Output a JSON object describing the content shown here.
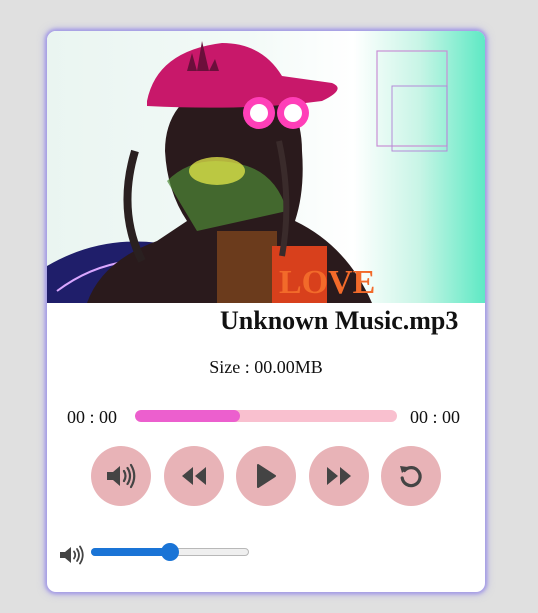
{
  "track": {
    "title": "Unknown Music.mp3",
    "size_label": "Size : ",
    "size_value": "00.00MB"
  },
  "progress": {
    "current_time": "00 : 00",
    "duration": "00 : 00",
    "fraction": 0.4
  },
  "controls": {
    "buttons": [
      {
        "icon": "volume-up-icon"
      },
      {
        "icon": "rewind-icon"
      },
      {
        "icon": "play-icon"
      },
      {
        "icon": "fast-forward-icon"
      },
      {
        "icon": "replay-icon"
      }
    ]
  },
  "volume": {
    "icon": "volume-icon",
    "level": 0.5
  },
  "colors": {
    "card_glow": "#a59ce6",
    "progress_track": "#f9c0cf",
    "progress_fill": "#ec5fce",
    "control_button": "#e8b3b7",
    "volume_accent": "#1a74d6"
  }
}
